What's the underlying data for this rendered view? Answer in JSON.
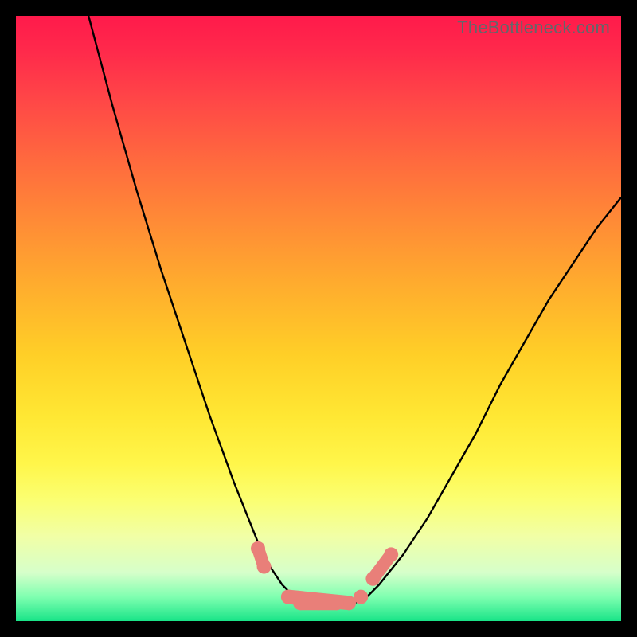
{
  "watermark": "TheBottleneck.com",
  "chart_data": {
    "type": "line",
    "title": "",
    "xlabel": "",
    "ylabel": "",
    "xlim": [
      0,
      100
    ],
    "ylim": [
      0,
      100
    ],
    "grid": false,
    "legend": false,
    "background_gradient": {
      "top": "#ff1a4b",
      "mid": "#ffe733",
      "bottom": "#19e488"
    },
    "series": [
      {
        "name": "left-curve",
        "stroke": "#000000",
        "x": [
          12,
          16,
          20,
          24,
          28,
          32,
          36,
          40,
          42,
          44,
          46
        ],
        "y": [
          100,
          85,
          71,
          58,
          46,
          34,
          23,
          13,
          9,
          6,
          4
        ]
      },
      {
        "name": "right-curve",
        "stroke": "#000000",
        "x": [
          58,
          60,
          64,
          68,
          72,
          76,
          80,
          84,
          88,
          92,
          96,
          100
        ],
        "y": [
          4,
          6,
          11,
          17,
          24,
          31,
          39,
          46,
          53,
          59,
          65,
          70
        ]
      },
      {
        "name": "valley-floor",
        "stroke": "#000000",
        "x": [
          46,
          48,
          50,
          52,
          54,
          56,
          58
        ],
        "y": [
          4,
          3,
          3,
          3,
          3,
          3,
          4
        ]
      },
      {
        "name": "highlight-markers",
        "stroke": "#e97f79",
        "points": [
          {
            "x": 40,
            "y": 12
          },
          {
            "x": 41,
            "y": 9
          },
          {
            "x": 45,
            "y": 4
          },
          {
            "x": 47,
            "y": 3
          },
          {
            "x": 50,
            "y": 3
          },
          {
            "x": 53,
            "y": 3
          },
          {
            "x": 55,
            "y": 3
          },
          {
            "x": 57,
            "y": 4
          },
          {
            "x": 59,
            "y": 7
          },
          {
            "x": 62,
            "y": 11
          }
        ]
      }
    ]
  }
}
